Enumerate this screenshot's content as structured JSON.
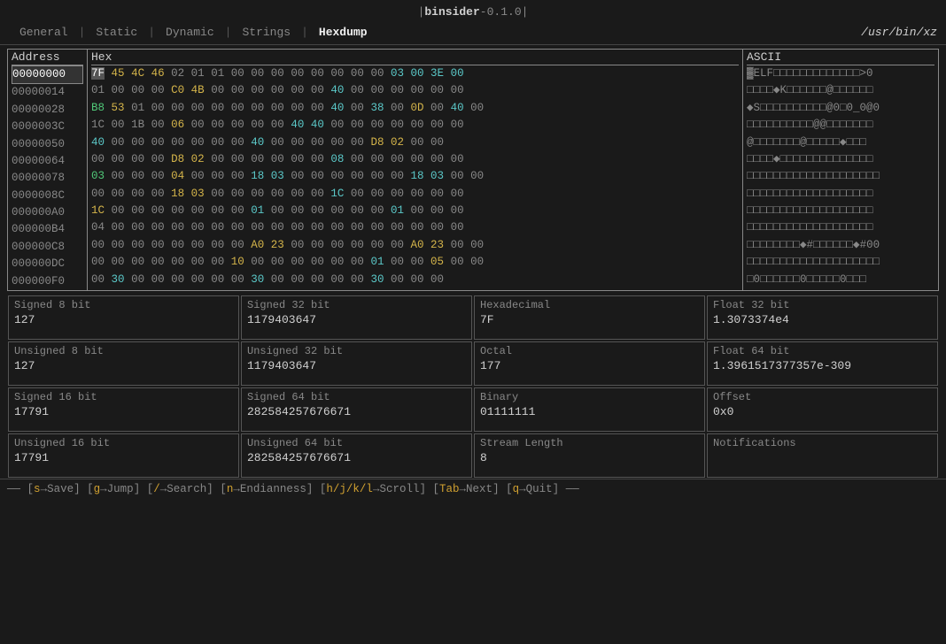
{
  "title": {
    "app": "binsider",
    "version": "0.1.0",
    "separator_left": "|",
    "separator_right": "|"
  },
  "tabs": [
    {
      "id": "general",
      "label": "General",
      "active": false
    },
    {
      "id": "static",
      "label": "Static",
      "active": false
    },
    {
      "id": "dynamic",
      "label": "Dynamic",
      "active": false
    },
    {
      "id": "strings",
      "label": "Strings",
      "active": false
    },
    {
      "id": "hexdump",
      "label": "Hexdump",
      "active": true
    }
  ],
  "filepath": "/usr/bin/xz",
  "hexdump": {
    "address_header": "Address",
    "hex_header": "Hex",
    "ascii_header": "ASCII",
    "rows": [
      {
        "address": "00000000",
        "selected": true,
        "hex": "7F 45 4C 46 02 01 01 00 00 00 00 00 00 00 00 03 00 3E 00",
        "ascii": "▓ELF□□□□□□□□□□□□>0"
      },
      {
        "address": "00000014",
        "selected": false,
        "hex": "01 00 00 00 C0 4B 00 00 00 00 00 00 40 00 00 00 00 00 00",
        "ascii": "□□□□◆K□□□□□□@□□□□□□"
      },
      {
        "address": "00000028",
        "selected": false,
        "hex": "B8 53 01 00 00 00 00 00 00 00 00 00 40 00 38 00 0D 00 40 00",
        "ascii": "◆S□□□□□□□□□□@080_0@0"
      },
      {
        "address": "0000003C",
        "selected": false,
        "hex": "1C 00 1B 00 06 00 00 00 00 00 40 40 00 00 00 00 00 00 00",
        "ascii": "□□□□□□□□□□@@□□□□□□□"
      },
      {
        "address": "00000050",
        "selected": false,
        "hex": "40 00 00 00 00 00 00 00 40 00 00 00 00 00 D8 02 00 00",
        "ascii": "@□□□□□□□@□□□□□◆□□□"
      },
      {
        "address": "00000064",
        "selected": false,
        "hex": "00 00 00 00 D8 02 00 00 00 00 00 00 08 00 00 00 00 00 00",
        "ascii": "□□□□◆□□□□□□□□□□□□□□"
      },
      {
        "address": "00000078",
        "selected": false,
        "hex": "03 00 00 00 04 00 00 00 18 03 00 00 00 00 00 00 18 03 00 00",
        "ascii": "□□□□□□□□□□□□□□□□□□□□"
      },
      {
        "address": "0000008C",
        "selected": false,
        "hex": "00 00 00 00 18 03 00 00 00 00 00 00 1C 00 00 00 00 00 00",
        "ascii": "□□□□□□□□□□□□□□□□□□□"
      },
      {
        "address": "000000A0",
        "selected": false,
        "hex": "1C 00 00 00 00 00 00 00 01 00 00 00 00 00 00 01 00 00 00",
        "ascii": "□□□□□□□□□□□□□□□□□□□"
      },
      {
        "address": "000000B4",
        "selected": false,
        "hex": "04 00 00 00 00 00 00 00 00 00 00 00 00 00 00 00 00 00 00",
        "ascii": "□□□□□□□□□□□□□□□□□□□"
      },
      {
        "address": "000000C8",
        "selected": false,
        "hex": "00 00 00 00 00 00 00 00 A0 23 00 00 00 00 00 00 A0 23 00 00",
        "ascii": "□□□□□□□□◆#□□□□□□◆#00"
      },
      {
        "address": "000000DC",
        "selected": false,
        "hex": "00 00 00 00 00 00 00 10 00 00 00 00 00 00 01 00 00 05 00 00",
        "ascii": "□□□□□□□□□□□□□□□□□□□□"
      },
      {
        "address": "000000F0",
        "selected": false,
        "hex": "00 30 00 00 00 00 00 00 30 00 00 00 00 00 30 00 00 00",
        "ascii": "□0□□□□□□0□□□□□0□□□"
      }
    ]
  },
  "info_panels": {
    "signed_8bit": {
      "label": "Signed 8 bit",
      "value": "127"
    },
    "signed_32bit": {
      "label": "Signed 32 bit",
      "value": "1179403647"
    },
    "hexadecimal": {
      "label": "Hexadecimal",
      "value": "7F"
    },
    "float_32bit": {
      "label": "Float 32 bit",
      "value": "1.3073374e4"
    },
    "unsigned_8bit": {
      "label": "Unsigned 8 bit",
      "value": "127"
    },
    "unsigned_32bit": {
      "label": "Unsigned 32 bit",
      "value": "1179403647"
    },
    "octal": {
      "label": "Octal",
      "value": "177"
    },
    "float_64bit": {
      "label": "Float 64 bit",
      "value": "1.3961517377357e-309"
    },
    "signed_16bit": {
      "label": "Signed 16 bit",
      "value": "17791"
    },
    "signed_64bit": {
      "label": "Signed 64 bit",
      "value": "282584257676671"
    },
    "binary": {
      "label": "Binary",
      "value": "01111111"
    },
    "offset": {
      "label": "Offset",
      "value": "0x0"
    },
    "unsigned_16bit": {
      "label": "Unsigned 16 bit",
      "value": "17791"
    },
    "unsigned_64bit": {
      "label": "Unsigned 64 bit",
      "value": "282584257676671"
    },
    "stream_length": {
      "label": "Stream Length",
      "value": "8"
    },
    "notifications": {
      "label": "Notifications",
      "value": ""
    }
  },
  "status_bar": {
    "items": [
      {
        "key": "s",
        "arrow": "→",
        "desc": "Save"
      },
      {
        "key": "g",
        "arrow": "→",
        "desc": "Jump"
      },
      {
        "key": "/",
        "arrow": "→",
        "desc": "Search"
      },
      {
        "key": "n",
        "arrow": "→",
        "desc": "Endianness"
      },
      {
        "key": "h/j/k/l",
        "arrow": "→",
        "desc": "Scroll"
      },
      {
        "key": "Tab",
        "arrow": "→",
        "desc": "Next"
      },
      {
        "key": "q",
        "arrow": "→",
        "desc": "Quit"
      }
    ]
  }
}
